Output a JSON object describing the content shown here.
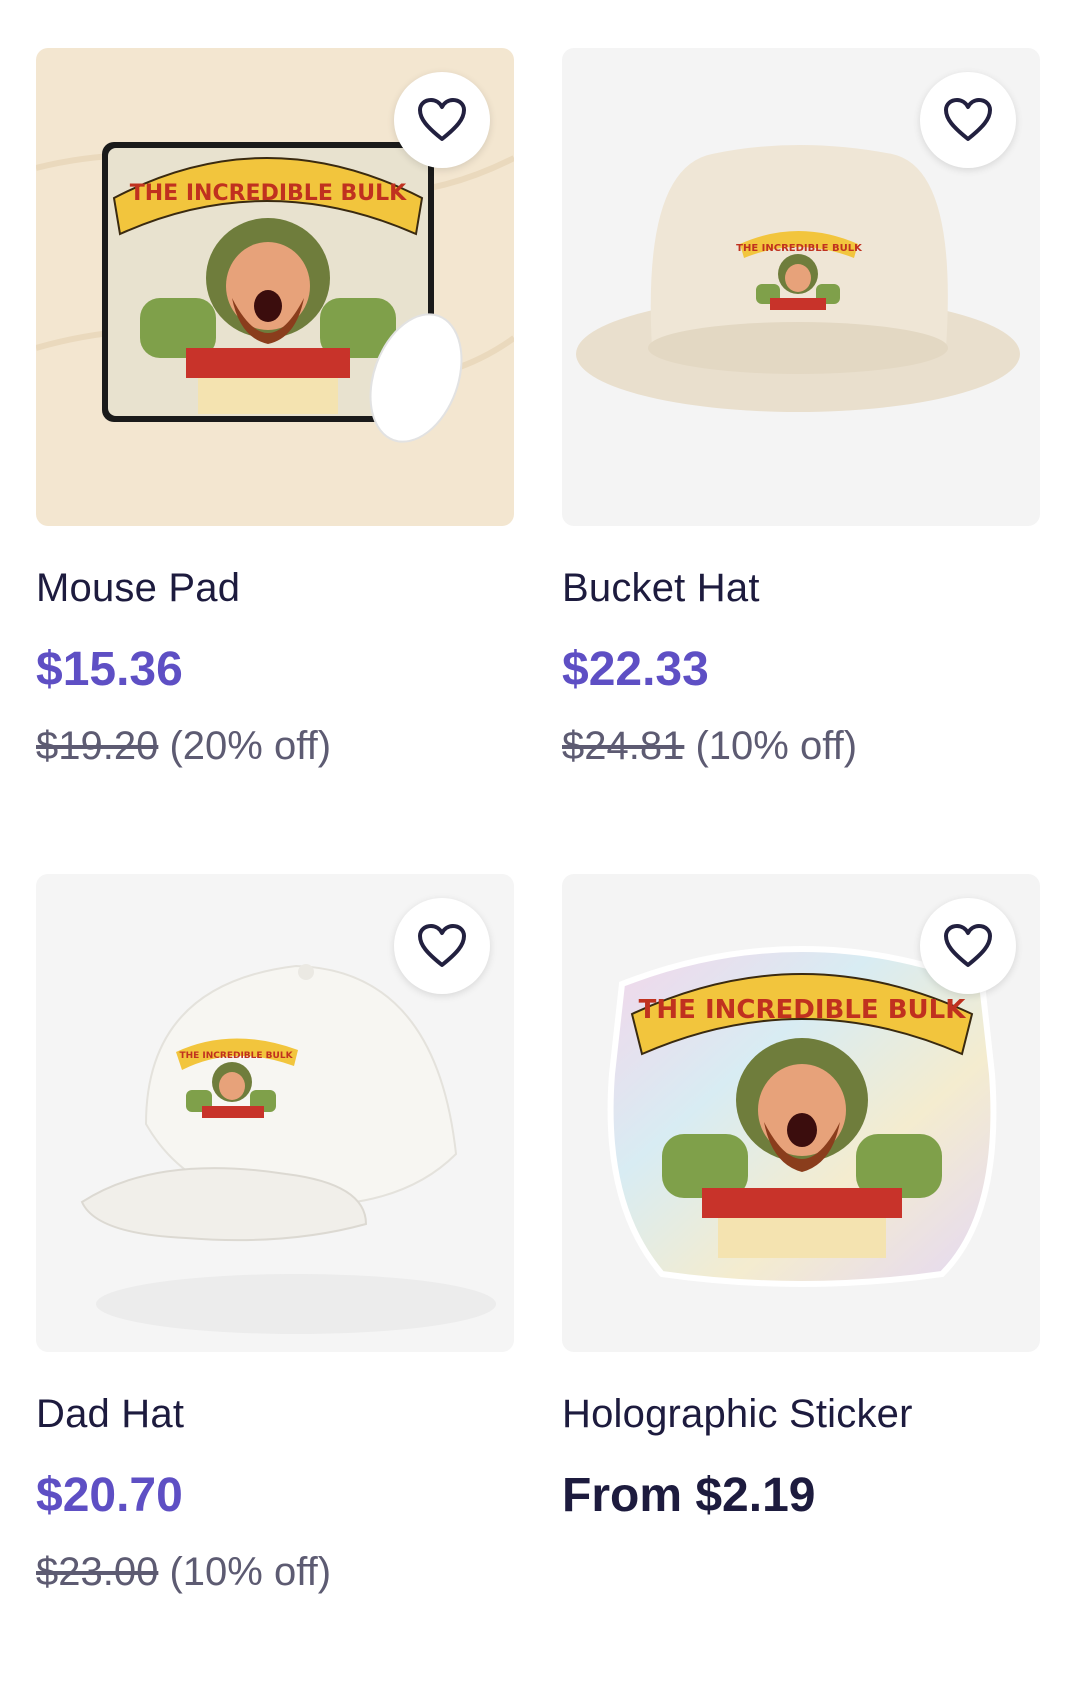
{
  "products": [
    {
      "name": "Mouse Pad",
      "price": "$15.36",
      "original_price": "$19.20",
      "discount": "(20% off)",
      "favorite_icon": "heart-outline-icon",
      "art_text": "THE INCREDIBLE BULK"
    },
    {
      "name": "Bucket Hat",
      "price": "$22.33",
      "original_price": "$24.81",
      "discount": "(10% off)",
      "favorite_icon": "heart-outline-icon",
      "art_text": "THE INCREDIBLE BULK"
    },
    {
      "name": "Dad Hat",
      "price": "$20.70",
      "original_price": "$23.00",
      "discount": "(10% off)",
      "favorite_icon": "heart-outline-icon",
      "art_text": "THE INCREDIBLE BULK"
    },
    {
      "name": "Holographic Sticker",
      "price": "From $2.19",
      "favorite_icon": "heart-outline-icon",
      "art_text": "THE INCREDIBLE BULK"
    }
  ],
  "colors": {
    "sale_price": "#5e4fc4",
    "regular_price": "#1d1b3e",
    "title": "#1d1b3e",
    "muted": "#5d5b72"
  }
}
